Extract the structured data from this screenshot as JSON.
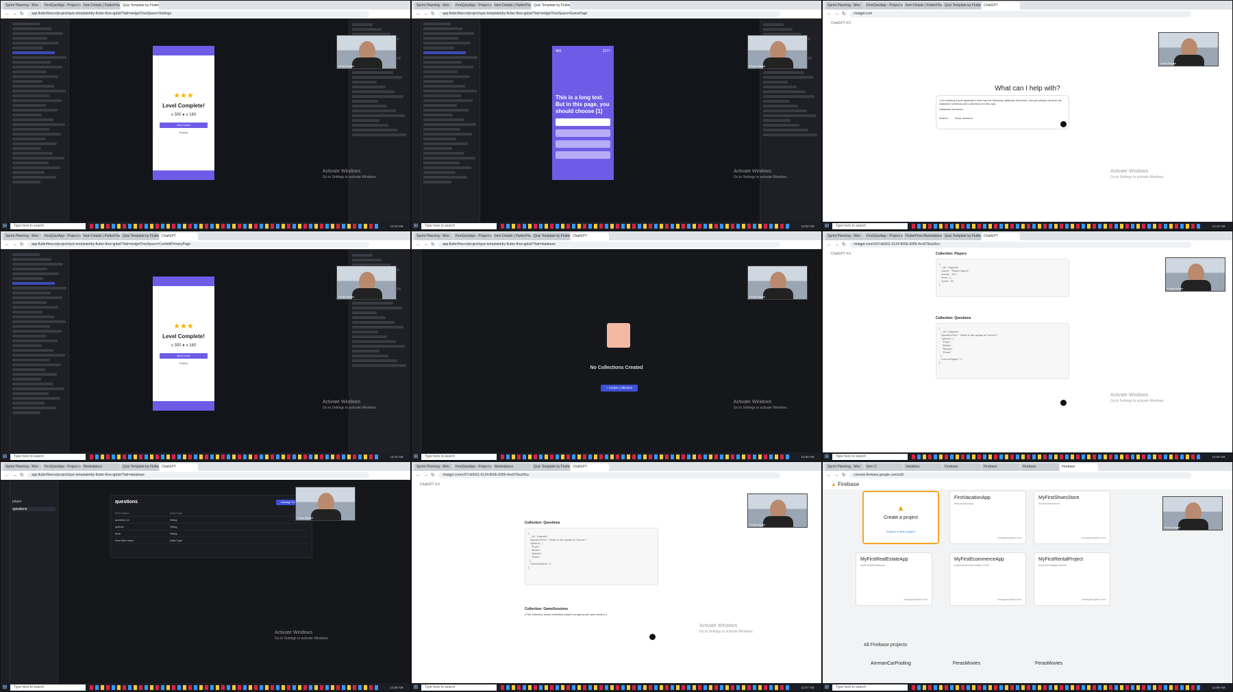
{
  "meta": {
    "width": 1800,
    "height": 1011
  },
  "tabs": {
    "t1": [
      "Sprint Planning - Miro",
      "FirstQuizApp - Project settings",
      "Item Details | FlutterFlow",
      "Quiz Template by FlutterFlow"
    ],
    "t2": [
      "Sprint Planning - Miro",
      "FirstQuizApp - Project settings",
      "Item Details | FlutterFlow",
      "Quiz Template by FlutterFlow"
    ],
    "t3": [
      "Sprint Planning - Miro",
      "FirstQuizApp - Project settings",
      "Item Details | FlutterFlow",
      "Quiz Template by FlutterFlow",
      "ChatGPT"
    ],
    "t4": [
      "Sprint Planning - Miro",
      "FirstQuizApp - Project settings",
      "Item Details | FlutterFlow",
      "Quiz Template by FlutterFlow",
      "ChatGPT"
    ],
    "t5": [
      "Sprint Planning - Miro",
      "FirstQuizApp - Project settings",
      "Item Details | FlutterFlow",
      "Quiz Template by FlutterFlow",
      "ChatGPT"
    ],
    "t6": [
      "Sprint Planning - Miro",
      "FirstQuizApp - Project settings",
      "FlutterFlow Marketplace",
      "Quiz Template by FlutterFlow",
      "ChatGPT"
    ],
    "t7": [
      "Sprint Planning - Miro",
      "FirstQuizApp - Project settings",
      "Marketplace",
      "Quiz Template by FlutterFlow",
      "ChatGPT"
    ],
    "t8": [
      "Sprint Planning - Miro",
      "FirstQuizApp - Project settings",
      "Marketplace",
      "Quiz Template by FlutterFlow",
      "ChatGPT"
    ],
    "t9": [
      "Sprint Planning - Miro",
      "Item D",
      "Variables",
      "Firebase",
      "Firebase",
      "Firebase",
      "Firebase"
    ]
  },
  "urls": {
    "t1": "app.flutterflow.io/project/quiz-templatebby-flutter-flow-qpbzl/?tab=widgetTreeSpace=Settings",
    "t2": "app.flutterflow.io/project/quiz-templatebby-flutter-flow-qpbzl/?tab=widgetTreeSpace=GamePage",
    "t3": "chatgpt.com",
    "t4": "app.flutterflow.io/project/quiz-templatebby-flutter-flow-qpbzl/?tab=widgetTreeSpace=ConfettiPrimaryPage",
    "t5": "app.flutterflow.io/project/quiz-templatebby-flutter-flow-qpbzl/?tab=database",
    "t6": "chatgpt.com/c/67cb0d11-5124-800b-9286-4ec879ea26cc",
    "t7": "app.flutterflow.io/project/quiz-templatebby-flutter-flow-qpbzl/?tab=database",
    "t8": "chatgpt.com/c/67cb0d11-5124-800b-9286-4ec879ea26cc",
    "t9": "console.firebase.google.com/u/0/"
  },
  "taskbar": {
    "search_placeholder": "Type here to search",
    "times": [
      "12:10 AM",
      "12:52 AM",
      "12:12 AM",
      "12:10 AM",
      "12:50 AM",
      "12:55 AM",
      "12:56 AM",
      "12:57 AM",
      "12:58 AM"
    ]
  },
  "activate": {
    "title": "Activate Windows",
    "sub": "Go to Settings to activate Windows."
  },
  "webcam": {
    "tag": "Feras Rawat"
  },
  "flutterflow": {
    "level_complete": "Level Complete!",
    "score_left": "x 300",
    "score_right": "x 160",
    "next_level": "Next Level",
    "replay": "Replay",
    "long_text": "This is a long text. But in this page, you should choose [1]",
    "score_a": "450",
    "score_b": "2277",
    "no_collections_title": "No Collections Created",
    "create_collection": "+ Create Collection",
    "database_title": "questions",
    "manage_content": "Manage Content",
    "db_headers": [
      "Field Name",
      "Data Type"
    ],
    "db_fields": [
      {
        "name": "question_id",
        "type": "String"
      },
      {
        "name": "options",
        "type": "String"
      },
      {
        "name": "level",
        "type": "String"
      },
      {
        "name": "New field name",
        "type": "Data Type"
      }
    ],
    "collections": [
      "player",
      "questions"
    ]
  },
  "chatgpt": {
    "model": "ChatGPT 4.5",
    "heading": "What can I help with?",
    "prompt": "I am building a quiz application that has the following database elements, can you please develop the database schemas and collections for this app.",
    "prompt_extra": "Database elements:",
    "search_label": "Search",
    "deep_research_label": "Deep research",
    "collection_players": "Collection: Players",
    "collection_questions": "Collection: Questions",
    "collection_sessions": "Collection: GameSessions",
    "sessions_desc": "(This collection tracks individual player's progress per quiz session.)",
    "code_players": "{\n  \"_id\": ObjectId,\n  \"name\": \"Player Name\",\n  \"points\": 100,\n  \"level\": 1,\n  \"coins\": 50\n}",
    "code_questions": "{\n  \"_id\": ObjectId,\n  \"questionText\": \"What is the capital of France?\",\n  \"options\": [\n    \"Paris\",\n    \"Berlin\",\n    \"Madrid\",\n    \"Rome\"\n  ],\n  \"correctOption\": 0\n}"
  },
  "firebase": {
    "brand": "Firebase",
    "create_project": "Create a project",
    "demo_project": "Explore a demo project",
    "projects": [
      {
        "name": "FirstVacationApp",
        "sub": "firstvacationapp",
        "platform": "emergencyfish.com"
      },
      {
        "name": "MyFirstShoesStore",
        "sub": "myfirstshoesstore",
        "platform": "emergencyfish.com"
      },
      {
        "name": "MyFirstRealEstateApp",
        "sub": "myfirstrealestateapp",
        "platform": "emergencyfish.com"
      },
      {
        "name": "MyFirstEcommerceApp",
        "sub": "myfirstecommerceapp-c2112",
        "platform": "emergencyfish.com"
      },
      {
        "name": "MyFirstRentalProject",
        "sub": "myfirstrentalapp-8c638",
        "platform": "emergencyfish.com"
      }
    ],
    "all_projects": "All Firebase projects",
    "bottom_projects": [
      "AmmanCarPooling",
      "FerasMovies",
      "FerasMovies"
    ]
  }
}
